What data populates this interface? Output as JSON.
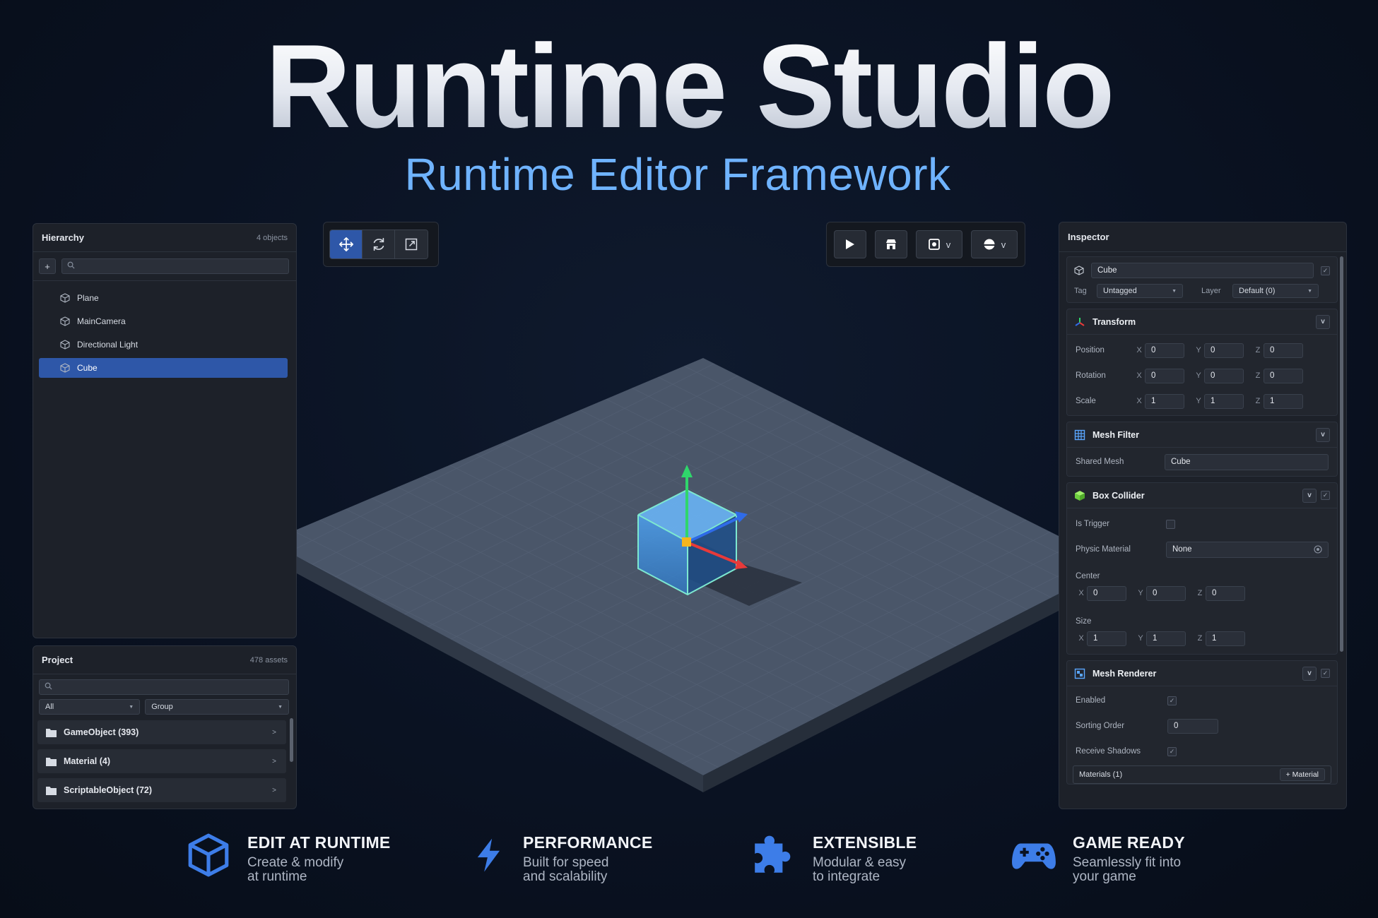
{
  "hero": {
    "title": "Runtime Studio",
    "subtitle": "Runtime Editor Framework"
  },
  "hierarchy": {
    "title": "Hierarchy",
    "count": "4 objects",
    "add_label": "+",
    "items": [
      {
        "label": "Plane"
      },
      {
        "label": "MainCamera"
      },
      {
        "label": "Directional Light"
      },
      {
        "label": "Cube",
        "selected": true
      }
    ]
  },
  "project": {
    "title": "Project",
    "count": "478 assets",
    "filter": "All",
    "group": "Group",
    "folders": [
      {
        "label": "GameObject (393)"
      },
      {
        "label": "Material (4)"
      },
      {
        "label": "ScriptableObject (72)"
      }
    ],
    "chevron": ">"
  },
  "scene_toolbar": {
    "tools": [
      "move-icon",
      "rotate-icon",
      "scale-icon"
    ],
    "active_tool": "move"
  },
  "play_toolbar": {
    "dropdown_caret": "v"
  },
  "inspector": {
    "title": "Inspector",
    "object_name": "Cube",
    "tag_label": "Tag",
    "tag_value": "Untagged",
    "layer_label": "Layer",
    "layer_value": "Default (0)",
    "transform": {
      "title": "Transform",
      "collapse": "v",
      "position_label": "Position",
      "rotation_label": "Rotation",
      "scale_label": "Scale",
      "axis_x": "X",
      "axis_y": "Y",
      "axis_z": "Z",
      "position": [
        "0",
        "0",
        "0"
      ],
      "rotation": [
        "0",
        "0",
        "0"
      ],
      "scale": [
        "1",
        "1",
        "1"
      ]
    },
    "mesh_filter": {
      "title": "Mesh Filter",
      "collapse": "v",
      "shared_mesh_label": "Shared Mesh",
      "shared_mesh_value": "Cube"
    },
    "box_collider": {
      "title": "Box Collider",
      "collapse": "v",
      "is_trigger_label": "Is Trigger",
      "physic_material_label": "Physic Material",
      "physic_material_value": "None",
      "center_label": "Center",
      "size_label": "Size",
      "center": [
        "0",
        "0",
        "0"
      ],
      "size": [
        "1",
        "1",
        "1"
      ]
    },
    "mesh_renderer": {
      "title": "Mesh Renderer",
      "collapse": "v",
      "enabled_label": "Enabled",
      "sorting_order_label": "Sorting Order",
      "sorting_order_value": "0",
      "receive_shadows_label": "Receive Shadows",
      "materials_label": "Materials (1)",
      "material_button": "+ Material"
    }
  },
  "features": [
    {
      "icon": "cube-icon",
      "title": "EDIT AT RUNTIME",
      "line1": "Create & modify",
      "line2": "at runtime"
    },
    {
      "icon": "lightning-icon",
      "title": "PERFORMANCE",
      "line1": "Built for speed",
      "line2": "and scalability"
    },
    {
      "icon": "puzzle-icon",
      "title": "EXTENSIBLE",
      "line1": "Modular & easy",
      "line2": "to integrate"
    },
    {
      "icon": "gamepad-icon",
      "title": "GAME READY",
      "line1": "Seamlessly fit into",
      "line2": "your game"
    }
  ],
  "colors": {
    "accent": "#2e57a8",
    "subtitle": "#6fb3ff",
    "feature_icon": "#3d7de8"
  }
}
